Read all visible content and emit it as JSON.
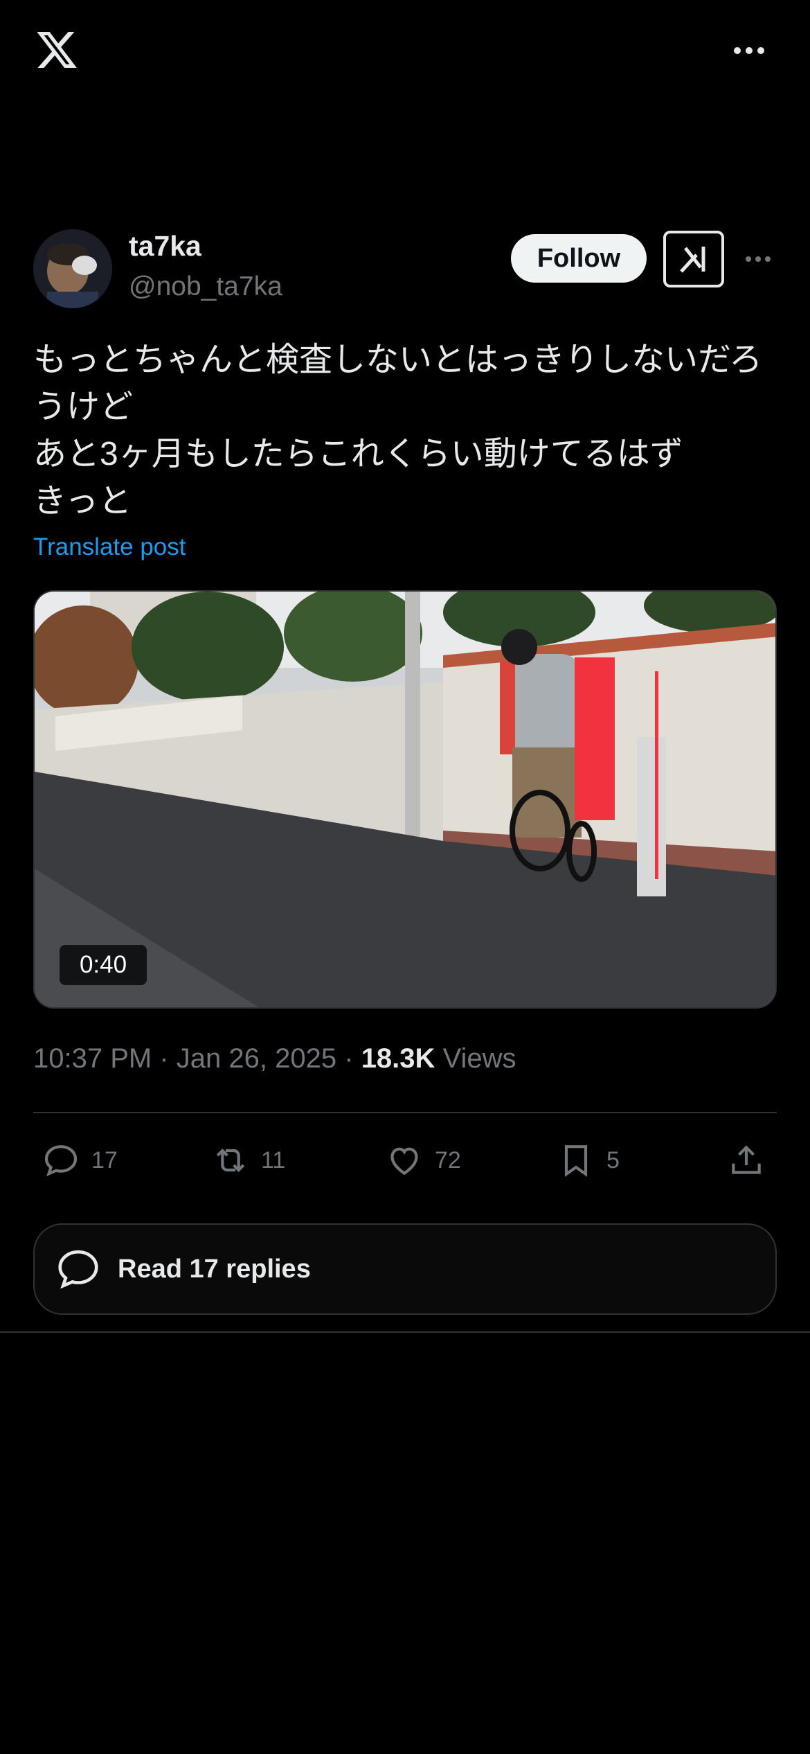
{
  "app": {
    "logo_icon": "x-logo-icon",
    "more_icon": "more-horizontal-icon"
  },
  "post": {
    "author": {
      "display_name": "ta7ka",
      "handle": "@nob_ta7ka"
    },
    "follow_label": "Follow",
    "grok_icon": "grok-icon",
    "text": "もっとちゃんと検査しないとはっきりしないだろうけど\nあと3ヶ月もしたらこれくらい動けてるはず\nきっと",
    "translate_label": "Translate post",
    "media": {
      "type": "video",
      "duration": "0:40"
    },
    "meta": {
      "time": "10:37 PM",
      "sep": "·",
      "date": "Jan 26, 2025",
      "views_count": "18.3K",
      "views_label": "Views"
    },
    "actions": {
      "replies": "17",
      "reposts": "11",
      "likes": "72",
      "bookmarks": "5"
    },
    "read_replies_label": "Read 17 replies"
  },
  "colors": {
    "background": "#000000",
    "text": "#e7e9ea",
    "muted": "#71767b",
    "link": "#1d9bf0",
    "border": "#2f3336"
  }
}
